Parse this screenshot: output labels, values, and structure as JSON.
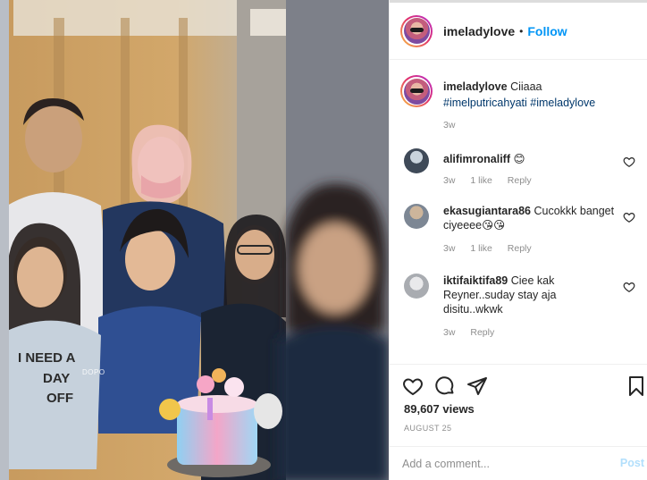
{
  "post": {
    "username": "imeladylove",
    "follow_label": "Follow",
    "dot": "•",
    "caption_text": "Ciiaaa",
    "hashtags": [
      "#imelputricahyati",
      "#imeladylove"
    ],
    "caption_time": "3w",
    "views": "89,607 views",
    "date": "August 25"
  },
  "media": {
    "watermark": "DOPO",
    "shirt_text": [
      "I NEED A",
      "DAY",
      "OFF"
    ]
  },
  "comments": [
    {
      "user": "alifimronaliff",
      "text": "😊",
      "time": "3w",
      "likes": "1 like",
      "reply": "Reply"
    },
    {
      "user": "ekasugiantara86",
      "text": "Cucokkk banget ciyeeee😘😘",
      "time": "3w",
      "likes": "1 like",
      "reply": "Reply"
    },
    {
      "user": "iktifaiktifa89",
      "text": "Ciee kak Reyner..suday stay aja disitu..wkwk",
      "time": "3w",
      "likes": "",
      "reply": "Reply"
    }
  ],
  "composer": {
    "placeholder": "Add a comment...",
    "post_label": "Post"
  },
  "icons": {
    "like": "heart-icon",
    "comment": "comment-icon",
    "share": "share-icon",
    "save": "bookmark-icon"
  },
  "colors": {
    "link_blue": "#0095f6",
    "hashtag": "#00376b",
    "muted": "#8e8e8e",
    "post_disabled": "#b2dffc"
  }
}
